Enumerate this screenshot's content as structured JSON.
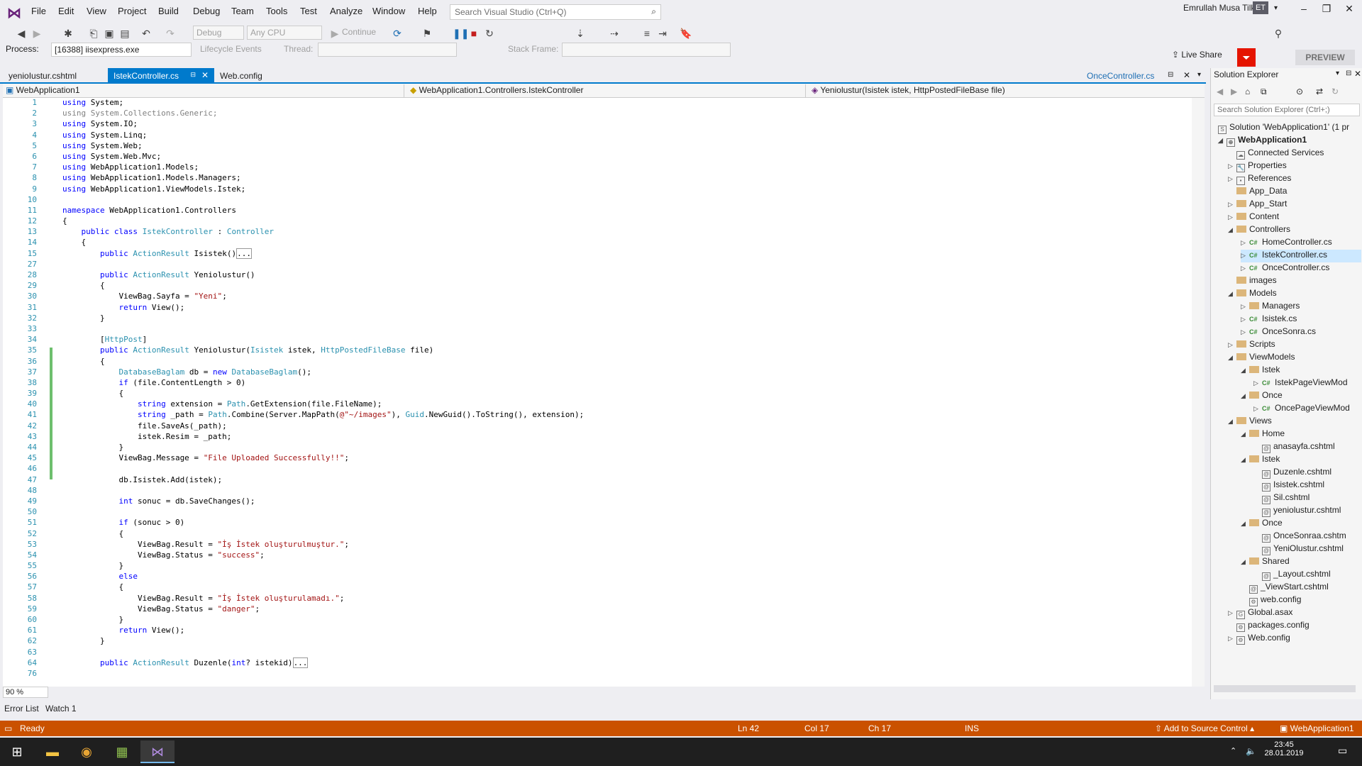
{
  "menu": [
    "File",
    "Edit",
    "View",
    "Project",
    "Build",
    "Debug",
    "Team",
    "Tools",
    "Test",
    "Analyze",
    "Window",
    "Help"
  ],
  "search": {
    "placeholder": "Search Visual Studio (Ctrl+Q)"
  },
  "user": {
    "name": "Emrullah Musa Tilki",
    "initials": "ET"
  },
  "toolbar": {
    "config": "Debug",
    "platform": "Any CPU",
    "continue": "Continue",
    "live_share": "Live Share",
    "preview": "PREVIEW",
    "process_label": "Process:",
    "process_value": "[16388] iisexpress.exe",
    "lifecycle": "Lifecycle Events",
    "thread": "Thread:",
    "stack_frame": "Stack Frame:"
  },
  "doc_tabs": [
    "yenioIustur.cshtml",
    "IstekController.cs",
    "Web.config"
  ],
  "preview_tab": "OnceController.cs",
  "nav": {
    "project": "WebApplication1",
    "class": "WebApplication1.Controllers.IstekController",
    "member": "Yeniolustur(Isistek istek, HttpPostedFileBase file)"
  },
  "line_numbers": [
    "1",
    "2",
    "3",
    "4",
    "5",
    "6",
    "7",
    "8",
    "9",
    "10",
    "11",
    "12",
    "13",
    "14",
    "15",
    "27",
    "28",
    "29",
    "30",
    "31",
    "32",
    "33",
    "34",
    "35",
    "36",
    "37",
    "38",
    "39",
    "40",
    "41",
    "42",
    "43",
    "44",
    "45",
    "46",
    "47",
    "48",
    "49",
    "50",
    "51",
    "52",
    "53",
    "54",
    "55",
    "56",
    "57",
    "58",
    "59",
    "60",
    "61",
    "62",
    "63",
    "64",
    "76"
  ],
  "zoom": "90 %",
  "bottom_tabs": [
    "Error List",
    "Watch 1"
  ],
  "status": {
    "ready": "Ready",
    "ln": "Ln 42",
    "col": "Col 17",
    "ch": "Ch 17",
    "ins": "INS",
    "source_control": "Add to Source Control",
    "repo": "WebApplication1"
  },
  "clock": {
    "time": "23:45",
    "date": "28.01.2019"
  },
  "solution_explorer": {
    "title": "Solution Explorer",
    "search_placeholder": "Search Solution Explorer (Ctrl+;)",
    "nodes": [
      {
        "label": "Solution 'WebApplication1' (1 pr",
        "kind": "solution"
      },
      {
        "label": "WebApplication1",
        "kind": "project"
      },
      {
        "label": "Connected Services",
        "kind": "service"
      },
      {
        "label": "Properties",
        "kind": "wrench"
      },
      {
        "label": "References",
        "kind": "ref"
      },
      {
        "label": "App_Data",
        "kind": "folder"
      },
      {
        "label": "App_Start",
        "kind": "folder"
      },
      {
        "label": "Content",
        "kind": "folder"
      },
      {
        "label": "Controllers",
        "kind": "folder"
      },
      {
        "label": "HomeController.cs",
        "kind": "cs"
      },
      {
        "label": "IstekController.cs",
        "kind": "cs"
      },
      {
        "label": "OnceController.cs",
        "kind": "cs"
      },
      {
        "label": "images",
        "kind": "folder"
      },
      {
        "label": "Models",
        "kind": "folder"
      },
      {
        "label": "Managers",
        "kind": "folder"
      },
      {
        "label": "Isistek.cs",
        "kind": "cs"
      },
      {
        "label": "OnceSonra.cs",
        "kind": "cs"
      },
      {
        "label": "Scripts",
        "kind": "folder"
      },
      {
        "label": "ViewModels",
        "kind": "folder"
      },
      {
        "label": "Istek",
        "kind": "folder"
      },
      {
        "label": "IstekPageViewMod",
        "kind": "cs"
      },
      {
        "label": "Once",
        "kind": "folder"
      },
      {
        "label": "OncePageViewMod",
        "kind": "cs"
      },
      {
        "label": "Views",
        "kind": "folder"
      },
      {
        "label": "Home",
        "kind": "folder"
      },
      {
        "label": "anasayfa.cshtml",
        "kind": "file"
      },
      {
        "label": "Istek",
        "kind": "folder"
      },
      {
        "label": "Duzenle.cshtml",
        "kind": "file"
      },
      {
        "label": "Isistek.cshtml",
        "kind": "file"
      },
      {
        "label": "Sil.cshtml",
        "kind": "file"
      },
      {
        "label": "yeniolustur.cshtml",
        "kind": "file"
      },
      {
        "label": "Once",
        "kind": "folder"
      },
      {
        "label": "OnceSonraa.cshtm",
        "kind": "file"
      },
      {
        "label": "YeniOlustur.cshtml",
        "kind": "file"
      },
      {
        "label": "Shared",
        "kind": "folder"
      },
      {
        "label": "_Layout.cshtml",
        "kind": "file"
      },
      {
        "label": "_ViewStart.cshtml",
        "kind": "file"
      },
      {
        "label": "web.config",
        "kind": "file"
      },
      {
        "label": "Global.asax",
        "kind": "file"
      },
      {
        "label": "packages.config",
        "kind": "file"
      },
      {
        "label": "Web.config",
        "kind": "file"
      }
    ]
  }
}
